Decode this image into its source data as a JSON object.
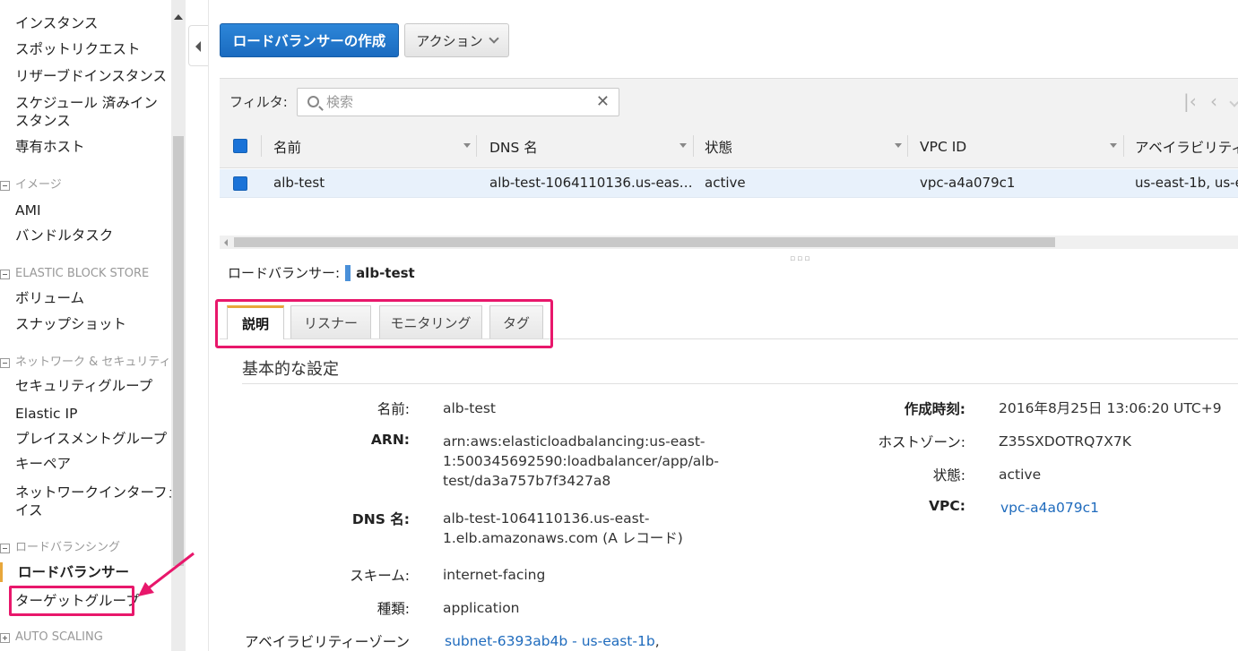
{
  "sidebar": {
    "items": {
      "instances": "インスタンス",
      "spot_requests": "スポットリクエスト",
      "reserved_instances": "リザーブドインスタンス",
      "scheduled_line1": "スケジュール 済みイン",
      "scheduled_line2": "スタンス",
      "dedicated_hosts": "専有ホスト",
      "ami": "AMI",
      "bundle_tasks": "バンドルタスク",
      "volumes": "ボリューム",
      "snapshots": "スナップショット",
      "security_groups": "セキュリティグループ",
      "elastic_ip": "Elastic IP",
      "placement_groups": "プレイスメントグループ",
      "key_pairs": "キーペア",
      "network_interfaces_line1": "ネットワークインターフェ",
      "network_interfaces_line2": "イス",
      "load_balancers": "ロードバランサー",
      "target_groups": "ターゲットグループ"
    },
    "headers": {
      "images": "イメージ",
      "ebs": "ELASTIC BLOCK STORE",
      "network_security": "ネットワーク & セキュリティ",
      "load_balancing": "ロードバランシング",
      "auto_scaling": "AUTO SCALING"
    }
  },
  "toolbar": {
    "create_label": "ロードバランサーの作成",
    "action_label": "アクション"
  },
  "filter": {
    "label": "フィルタ:",
    "placeholder": "検索",
    "clear": "✕"
  },
  "pager": {
    "first": "|‹",
    "prev": "‹"
  },
  "table": {
    "columns": [
      "名前",
      "DNS 名",
      "状態",
      "VPC ID",
      "アベイラビリティー"
    ],
    "rows": [
      {
        "name": "alb-test",
        "dns": "alb-test-1064110136.us-eas…",
        "state": "active",
        "vpc": "vpc-a4a079c1",
        "az": "us-east-1b, us-e"
      }
    ]
  },
  "detail": {
    "title_label": "ロードバランサー:",
    "title_name": "alb-test",
    "tabs": [
      "説明",
      "リスナー",
      "モニタリング",
      "タグ"
    ],
    "section_title": "基本的な設定",
    "left": {
      "name_label": "名前:",
      "name_value": "alb-test",
      "arn_label": "ARN:",
      "arn_value": "arn:aws:elasticloadbalancing:us-east-\n1:500345692590:loadbalancer/app/alb-\ntest/da3a757b7f3427a8",
      "dns_label": "DNS 名:",
      "dns_value": "alb-test-1064110136.us-east-\n1.elb.amazonaws.com (A レコード)",
      "scheme_label": "スキーム:",
      "scheme_value": "internet-facing",
      "type_label": "種類:",
      "type_value": "application",
      "az_label": "アベイラビリティーゾーン",
      "az_value": "subnet-6393ab4b - us-east-1b"
    },
    "right": {
      "created_label": "作成時刻:",
      "created_value": "2016年8月25日 13:06:20 UTC+9",
      "zone_label": "ホストゾーン:",
      "zone_value": "Z35SXDOTRQ7X7K",
      "state_label": "状態:",
      "state_value": "active",
      "vpc_label": "VPC:",
      "vpc_value": "vpc-a4a079c1"
    }
  },
  "colors": {
    "accent_blue": "#1a6bc0",
    "highlight_pink": "#e8176b",
    "active_orange": "#e8a73b",
    "link_blue": "#1f6bbd"
  }
}
